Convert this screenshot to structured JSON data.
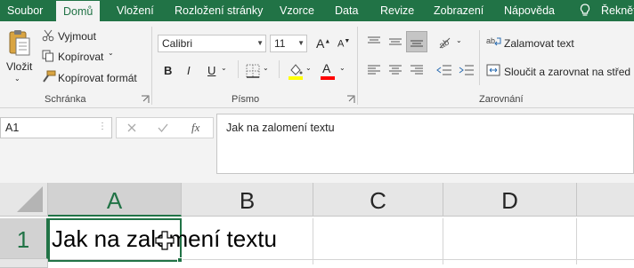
{
  "ribbon_tabs": {
    "soubor": "Soubor",
    "domu": "Domů",
    "vlozeni": "Vložení",
    "rozlozeni": "Rozložení stránky",
    "vzorce": "Vzorce",
    "data": "Data",
    "revize": "Revize",
    "zobrazeni": "Zobrazení",
    "napoveda": "Nápověda",
    "reknete": "Řekněte"
  },
  "clipboard": {
    "paste_label": "Vložit",
    "cut_label": "Vyjmout",
    "copy_label": "Kopírovat",
    "format_painter_label": "Kopírovat formát",
    "group_label": "Schránka"
  },
  "font": {
    "font_name": "Calibri",
    "font_size": "11",
    "bold": "B",
    "italic": "I",
    "underline": "U",
    "font_color_letter": "A",
    "grow_letter": "A",
    "shrink_letter": "A",
    "group_label": "Písmo",
    "highlight_color": "#ffff00",
    "font_color": "#ff0000"
  },
  "alignment": {
    "wrap_text_label": "Zalamovat text",
    "merge_center_label": "Sloučit a zarovnat na střed",
    "group_label": "Zarovnání"
  },
  "formula_bar": {
    "name_box": "A1",
    "fx": "fx",
    "content": "Jak na zalomení textu"
  },
  "grid": {
    "columns": [
      "A",
      "B",
      "C",
      "D"
    ],
    "rows": [
      "1"
    ],
    "cell_a1": "Jak na zalomení textu"
  },
  "colors": {
    "accent": "#217346",
    "ribbon_bg": "#f3f3f3"
  }
}
